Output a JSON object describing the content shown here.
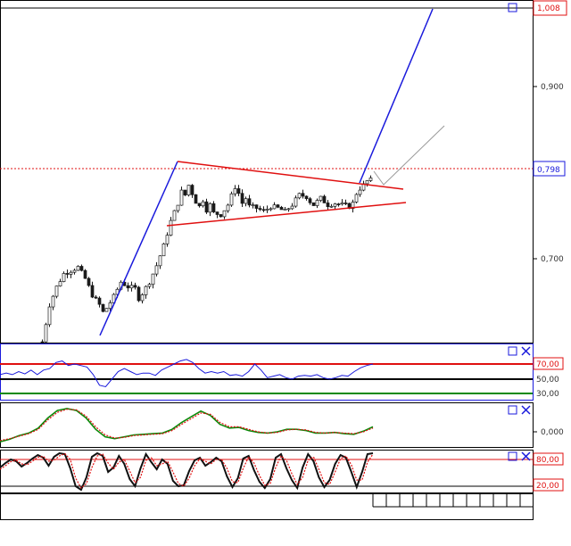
{
  "colors": {
    "background": "#ffffff",
    "frame": "#000000",
    "blue": "#1a1adc",
    "red": "#e01010",
    "green": "#0a8a0a",
    "gray": "#9a9a9a",
    "candle": "#1a1a1a"
  },
  "icons": [
    "restore-icon",
    "close-icon"
  ],
  "chart_data": [
    {
      "type": "candlestick",
      "panel": "price",
      "ylim": [
        0.6,
        1.008
      ],
      "y_ticks": [
        {
          "value": 0.9,
          "label": "0,900"
        },
        {
          "value": 0.7,
          "label": "0,700"
        }
      ],
      "top_level": {
        "value": 1.008,
        "label": "1,008"
      },
      "current_price": {
        "value": 0.798,
        "label": "0,798"
      },
      "close_path": [
        [
          0,
          0.601
        ],
        [
          2,
          0.646
        ],
        [
          4,
          0.668
        ],
        [
          6,
          0.684
        ],
        [
          8,
          0.688
        ],
        [
          10,
          0.692
        ],
        [
          12,
          0.678
        ],
        [
          14,
          0.658
        ],
        [
          16,
          0.646
        ],
        [
          17,
          0.637
        ],
        [
          18,
          0.642
        ],
        [
          20,
          0.656
        ],
        [
          22,
          0.674
        ],
        [
          24,
          0.668
        ],
        [
          26,
          0.666
        ],
        [
          27,
          0.654
        ],
        [
          28,
          0.66
        ],
        [
          30,
          0.674
        ],
        [
          32,
          0.694
        ],
        [
          34,
          0.718
        ],
        [
          36,
          0.748
        ],
        [
          38,
          0.77
        ],
        [
          39,
          0.784
        ],
        [
          40,
          0.78
        ],
        [
          41,
          0.792
        ],
        [
          42,
          0.782
        ],
        [
          43,
          0.772
        ],
        [
          44,
          0.766
        ],
        [
          45,
          0.774
        ],
        [
          46,
          0.762
        ],
        [
          47,
          0.768
        ],
        [
          48,
          0.758
        ],
        [
          50,
          0.756
        ],
        [
          52,
          0.768
        ],
        [
          54,
          0.79
        ],
        [
          55,
          0.782
        ],
        [
          56,
          0.77
        ],
        [
          57,
          0.776
        ],
        [
          58,
          0.766
        ],
        [
          60,
          0.764
        ],
        [
          62,
          0.76
        ],
        [
          64,
          0.766
        ],
        [
          66,
          0.764
        ],
        [
          68,
          0.76
        ],
        [
          70,
          0.768
        ],
        [
          72,
          0.78
        ],
        [
          74,
          0.778
        ],
        [
          75,
          0.772
        ],
        [
          76,
          0.768
        ],
        [
          78,
          0.776
        ],
        [
          80,
          0.768
        ],
        [
          82,
          0.77
        ],
        [
          84,
          0.768
        ],
        [
          86,
          0.766
        ],
        [
          87,
          0.77
        ],
        [
          88,
          0.782
        ],
        [
          89,
          0.788
        ],
        [
          90,
          0.792
        ],
        [
          91,
          0.797
        ],
        [
          92,
          0.798
        ]
      ],
      "annotations": {
        "triangle_upper": [
          [
            41,
            0.792
          ],
          [
            99,
            0.768
          ]
        ],
        "triangle_lower": [
          [
            39,
            0.76
          ],
          [
            99,
            0.772
          ]
        ],
        "impulse_leg": [
          [
            23,
            0.624
          ],
          [
            41,
            0.794
          ]
        ],
        "target_leg": [
          [
            86,
            0.782
          ],
          [
            102,
            1.0
          ]
        ],
        "projection_gray": [
          [
            90,
            0.786
          ],
          [
            92,
            0.774
          ],
          [
            106,
            0.823
          ]
        ]
      }
    },
    {
      "type": "line",
      "panel": "rsi",
      "ylim": [
        20,
        82
      ],
      "levels": [
        {
          "value": 70,
          "label": "70,00"
        },
        {
          "value": 50,
          "label": "50,00"
        },
        {
          "value": 30,
          "label": "30,00"
        }
      ],
      "series": [
        {
          "values": [
            56,
            58,
            56,
            60,
            57,
            62,
            56,
            62,
            64,
            72,
            74,
            68,
            70,
            68,
            66,
            56,
            42,
            40,
            50,
            60,
            64,
            60,
            56,
            58,
            58,
            55,
            62,
            66,
            70,
            74,
            76,
            72,
            64,
            58,
            60,
            58,
            60,
            55,
            56,
            54,
            60,
            70,
            62,
            52,
            54,
            56,
            52,
            50,
            54,
            55,
            54,
            56,
            52,
            50,
            52,
            55,
            54,
            60,
            65,
            68,
            70
          ]
        }
      ]
    },
    {
      "type": "line",
      "panel": "oscillator",
      "ylim": [
        -0.03,
        0.056
      ],
      "y_ticks": [
        {
          "value": 0.0,
          "label": "0,000"
        }
      ],
      "series": [
        {
          "values": [
            -0.016,
            -0.012,
            -0.006,
            -0.002,
            0.006,
            0.022,
            0.034,
            0.037,
            0.034,
            0.022,
            0.004,
            -0.008,
            -0.011,
            -0.008,
            -0.005,
            -0.004,
            -0.003,
            -0.002,
            0.004,
            0.015,
            0.024,
            0.033,
            0.026,
            0.012,
            0.006,
            0.007,
            0.002,
            -0.001,
            -0.002,
            0.0,
            0.004,
            0.004,
            0.002,
            -0.002,
            -0.002,
            -0.001,
            -0.003,
            -0.004,
            0.001,
            0.008
          ]
        },
        {
          "values": [
            -0.014,
            -0.011,
            -0.007,
            -0.003,
            0.004,
            0.019,
            0.031,
            0.036,
            0.035,
            0.025,
            0.008,
            -0.005,
            -0.01,
            -0.009,
            -0.006,
            -0.005,
            -0.004,
            -0.003,
            0.002,
            0.012,
            0.021,
            0.03,
            0.028,
            0.015,
            0.008,
            0.008,
            0.004,
            0.0,
            -0.002,
            -0.001,
            0.003,
            0.004,
            0.003,
            -0.001,
            -0.002,
            -0.001,
            -0.002,
            -0.003,
            0.0,
            0.006
          ]
        }
      ]
    },
    {
      "type": "line",
      "panel": "stochastic",
      "ylim": [
        0,
        100
      ],
      "levels": [
        {
          "value": 80,
          "label": "80,00"
        },
        {
          "value": 20,
          "label": "20,00"
        }
      ],
      "series": [
        {
          "values": [
            62,
            72,
            80,
            76,
            64,
            72,
            82,
            90,
            84,
            66,
            86,
            94,
            92,
            60,
            20,
            12,
            40,
            86,
            94,
            88,
            52,
            62,
            88,
            70,
            36,
            20,
            60,
            92,
            74,
            58,
            80,
            70,
            32,
            20,
            22,
            54,
            78,
            84,
            66,
            74,
            84,
            76,
            42,
            18,
            38,
            82,
            88,
            56,
            30,
            16,
            36,
            84,
            92,
            60,
            34,
            16,
            62,
            92,
            76,
            40,
            18,
            34,
            70,
            90,
            84,
            52,
            18,
            52,
            92,
            94
          ]
        },
        {
          "values": [
            58,
            66,
            75,
            78,
            70,
            68,
            76,
            85,
            87,
            76,
            78,
            88,
            93,
            80,
            38,
            16,
            26,
            62,
            88,
            92,
            72,
            58,
            74,
            80,
            54,
            28,
            40,
            78,
            84,
            66,
            70,
            76,
            52,
            26,
            20,
            38,
            66,
            82,
            76,
            70,
            80,
            80,
            60,
            30,
            28,
            60,
            86,
            72,
            44,
            22,
            26,
            62,
            88,
            78,
            48,
            24,
            40,
            78,
            86,
            58,
            28,
            24,
            52,
            82,
            88,
            68,
            34,
            34,
            74,
            92
          ]
        }
      ]
    }
  ]
}
